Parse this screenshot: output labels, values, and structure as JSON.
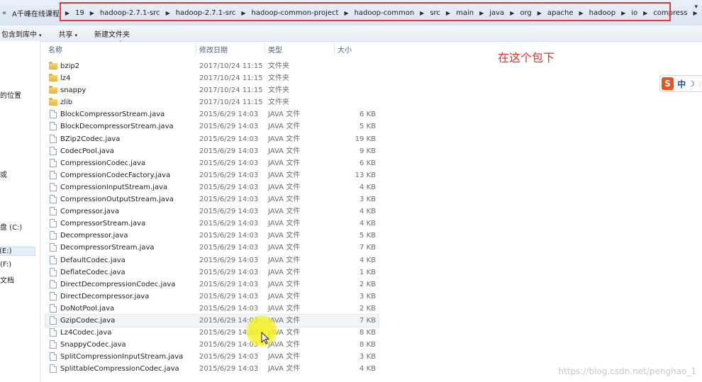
{
  "address_bar": {
    "overflow_glyph": "«",
    "segments": [
      "A千峰在线课程",
      "19",
      "hadoop-2.7.1-src",
      "hadoop-2.7.1-src",
      "hadoop-common-project",
      "hadoop-common",
      "src",
      "main",
      "java",
      "org",
      "apache",
      "hadoop",
      "io",
      "compress"
    ],
    "separator": "▶",
    "dropdown_glyph": "▾"
  },
  "toolbar": {
    "include_in_library": "包含到库中",
    "share": "共享",
    "new_folder": "新建文件夹",
    "caret": "▾"
  },
  "nav_pane": {
    "items": [
      "的位置",
      "或",
      "盘 (C:)",
      "(E:)",
      "(F:)",
      "文档"
    ]
  },
  "columns": {
    "name": "名称",
    "date": "修改日期",
    "type": "类型",
    "size": "大小"
  },
  "files": [
    {
      "name": "bzip2",
      "date": "2017/10/24 11:15",
      "type": "文件夹",
      "size": "",
      "kind": "folder"
    },
    {
      "name": "lz4",
      "date": "2017/10/24 11:15",
      "type": "文件夹",
      "size": "",
      "kind": "folder"
    },
    {
      "name": "snappy",
      "date": "2017/10/24 11:15",
      "type": "文件夹",
      "size": "",
      "kind": "folder"
    },
    {
      "name": "zlib",
      "date": "2017/10/24 11:15",
      "type": "文件夹",
      "size": "",
      "kind": "folder"
    },
    {
      "name": "BlockCompressorStream.java",
      "date": "2015/6/29 14:03",
      "type": "JAVA 文件",
      "size": "6 KB",
      "kind": "file"
    },
    {
      "name": "BlockDecompressorStream.java",
      "date": "2015/6/29 14:03",
      "type": "JAVA 文件",
      "size": "5 KB",
      "kind": "file"
    },
    {
      "name": "BZip2Codec.java",
      "date": "2015/6/29 14:03",
      "type": "JAVA 文件",
      "size": "19 KB",
      "kind": "file"
    },
    {
      "name": "CodecPool.java",
      "date": "2015/6/29 14:03",
      "type": "JAVA 文件",
      "size": "9 KB",
      "kind": "file"
    },
    {
      "name": "CompressionCodec.java",
      "date": "2015/6/29 14:03",
      "type": "JAVA 文件",
      "size": "6 KB",
      "kind": "file"
    },
    {
      "name": "CompressionCodecFactory.java",
      "date": "2015/6/29 14:03",
      "type": "JAVA 文件",
      "size": "13 KB",
      "kind": "file"
    },
    {
      "name": "CompressionInputStream.java",
      "date": "2015/6/29 14:03",
      "type": "JAVA 文件",
      "size": "4 KB",
      "kind": "file"
    },
    {
      "name": "CompressionOutputStream.java",
      "date": "2015/6/29 14:03",
      "type": "JAVA 文件",
      "size": "3 KB",
      "kind": "file"
    },
    {
      "name": "Compressor.java",
      "date": "2015/6/29 14:03",
      "type": "JAVA 文件",
      "size": "4 KB",
      "kind": "file"
    },
    {
      "name": "CompressorStream.java",
      "date": "2015/6/29 14:03",
      "type": "JAVA 文件",
      "size": "4 KB",
      "kind": "file"
    },
    {
      "name": "Decompressor.java",
      "date": "2015/6/29 14:03",
      "type": "JAVA 文件",
      "size": "5 KB",
      "kind": "file"
    },
    {
      "name": "DecompressorStream.java",
      "date": "2015/6/29 14:03",
      "type": "JAVA 文件",
      "size": "7 KB",
      "kind": "file"
    },
    {
      "name": "DefaultCodec.java",
      "date": "2015/6/29 14:03",
      "type": "JAVA 文件",
      "size": "4 KB",
      "kind": "file"
    },
    {
      "name": "DeflateCodec.java",
      "date": "2015/6/29 14:03",
      "type": "JAVA 文件",
      "size": "1 KB",
      "kind": "file"
    },
    {
      "name": "DirectDecompressionCodec.java",
      "date": "2015/6/29 14:03",
      "type": "JAVA 文件",
      "size": "2 KB",
      "kind": "file"
    },
    {
      "name": "DirectDecompressor.java",
      "date": "2015/6/29 14:03",
      "type": "JAVA 文件",
      "size": "3 KB",
      "kind": "file"
    },
    {
      "name": "DoNotPool.java",
      "date": "2015/6/29 14:03",
      "type": "JAVA 文件",
      "size": "2 KB",
      "kind": "file"
    },
    {
      "name": "GzipCodec.java",
      "date": "2015/6/29 14:03",
      "type": "JAVA 文件",
      "size": "7 KB",
      "kind": "file",
      "hovered": true
    },
    {
      "name": "Lz4Codec.java",
      "date": "2015/6/29 14:03",
      "type": "JAVA 文件",
      "size": "8 KB",
      "kind": "file"
    },
    {
      "name": "SnappyCodec.java",
      "date": "2015/6/29 14:03",
      "type": "JAVA 文件",
      "size": "8 KB",
      "kind": "file"
    },
    {
      "name": "SplitCompressionInputStream.java",
      "date": "2015/6/29 14:03",
      "type": "JAVA 文件",
      "size": "3 KB",
      "kind": "file"
    },
    {
      "name": "SplittableCompressionCodec.java",
      "date": "2015/6/29 14:03",
      "type": "JAVA 文件",
      "size": "4 KB",
      "kind": "file"
    }
  ],
  "annotation": {
    "text": "在这个包下",
    "color": "#e0302c"
  },
  "ime": {
    "logo": "S",
    "mode": "中",
    "moon": "☽",
    "dots": "⋮"
  },
  "watermark": "https://blog.csdn.net/penghao_1",
  "colors": {
    "highlight_box": "#e33b3b",
    "cursor_highlight": "#f5f028",
    "folder": "#e6b33a"
  }
}
